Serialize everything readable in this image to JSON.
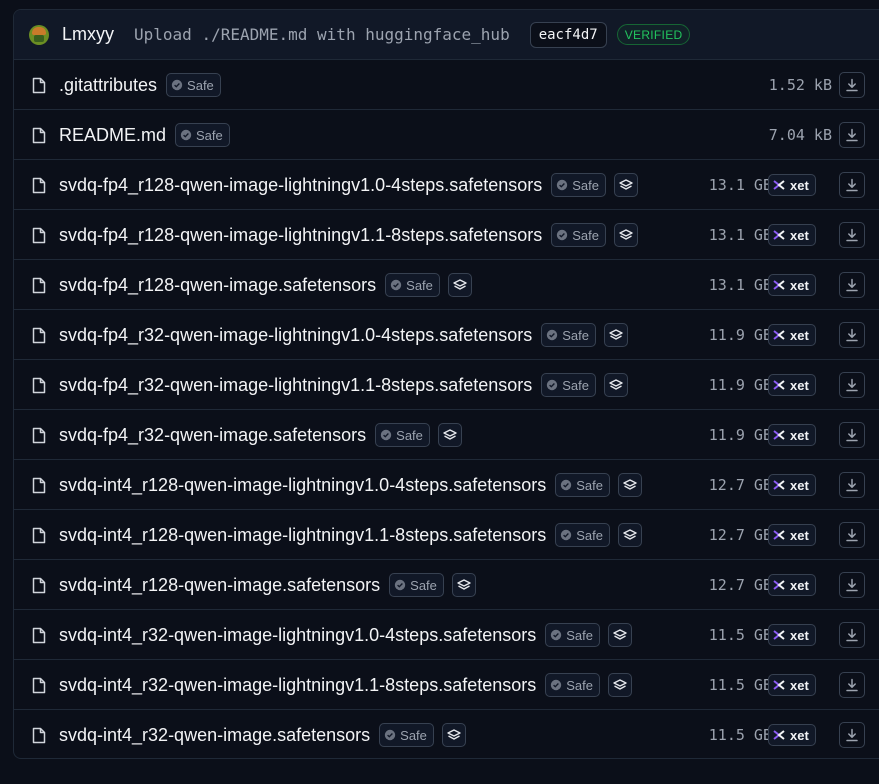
{
  "commit": {
    "author": "Lmxyy",
    "message": "Upload ./README.md with huggingface_hub",
    "sha": "eacf4d7",
    "verified_label": "VERIFIED"
  },
  "labels": {
    "safe": "Safe",
    "xet": "xet"
  },
  "colors": {
    "background": "#0b0f19",
    "verified": "#22c55e",
    "xet_accent": "#7c3aed"
  },
  "files": [
    {
      "name": ".gitattributes",
      "size": "1.52 kB",
      "safe": true,
      "stack_icon": false,
      "xet": false
    },
    {
      "name": "README.md",
      "size": "7.04 kB",
      "safe": true,
      "stack_icon": false,
      "xet": false
    },
    {
      "name": "svdq-fp4_r128-qwen-image-lightningv1.0-4steps.safetensors",
      "size": "13.1 GB",
      "safe": true,
      "stack_icon": true,
      "xet": true
    },
    {
      "name": "svdq-fp4_r128-qwen-image-lightningv1.1-8steps.safetensors",
      "size": "13.1 GB",
      "safe": true,
      "stack_icon": true,
      "xet": true
    },
    {
      "name": "svdq-fp4_r128-qwen-image.safetensors",
      "size": "13.1 GB",
      "safe": true,
      "stack_icon": true,
      "xet": true
    },
    {
      "name": "svdq-fp4_r32-qwen-image-lightningv1.0-4steps.safetensors",
      "size": "11.9 GB",
      "safe": true,
      "stack_icon": true,
      "xet": true
    },
    {
      "name": "svdq-fp4_r32-qwen-image-lightningv1.1-8steps.safetensors",
      "size": "11.9 GB",
      "safe": true,
      "stack_icon": true,
      "xet": true
    },
    {
      "name": "svdq-fp4_r32-qwen-image.safetensors",
      "size": "11.9 GB",
      "safe": true,
      "stack_icon": true,
      "xet": true
    },
    {
      "name": "svdq-int4_r128-qwen-image-lightningv1.0-4steps.safetensors",
      "size": "12.7 GB",
      "safe": true,
      "stack_icon": true,
      "xet": true
    },
    {
      "name": "svdq-int4_r128-qwen-image-lightningv1.1-8steps.safetensors",
      "size": "12.7 GB",
      "safe": true,
      "stack_icon": true,
      "xet": true
    },
    {
      "name": "svdq-int4_r128-qwen-image.safetensors",
      "size": "12.7 GB",
      "safe": true,
      "stack_icon": true,
      "xet": true
    },
    {
      "name": "svdq-int4_r32-qwen-image-lightningv1.0-4steps.safetensors",
      "size": "11.5 GB",
      "safe": true,
      "stack_icon": true,
      "xet": true
    },
    {
      "name": "svdq-int4_r32-qwen-image-lightningv1.1-8steps.safetensors",
      "size": "11.5 GB",
      "safe": true,
      "stack_icon": true,
      "xet": true
    },
    {
      "name": "svdq-int4_r32-qwen-image.safetensors",
      "size": "11.5 GB",
      "safe": true,
      "stack_icon": true,
      "xet": true
    }
  ]
}
